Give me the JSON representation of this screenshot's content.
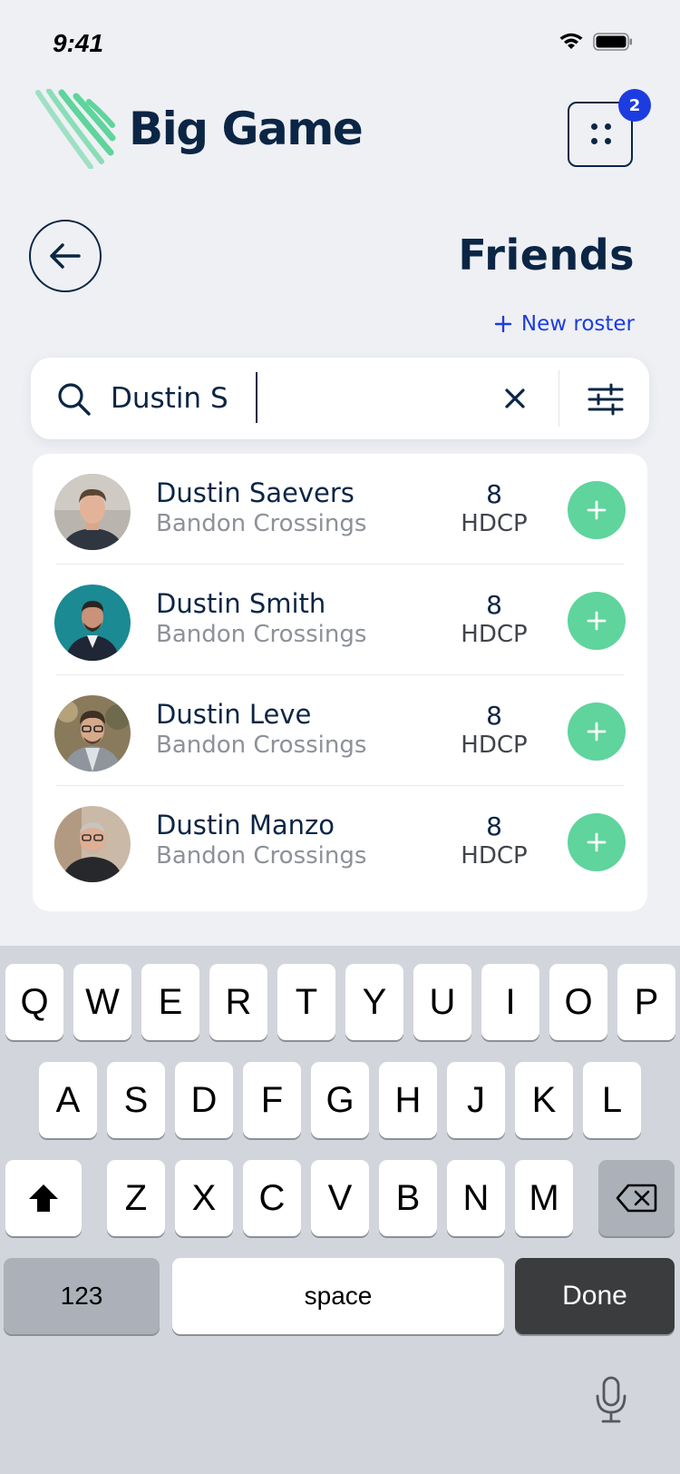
{
  "status_bar": {
    "time": "9:41"
  },
  "header": {
    "app_name": "Big Game",
    "notification_count": "2"
  },
  "page": {
    "title": "Friends",
    "new_roster_label": "New roster"
  },
  "search": {
    "value": "Dustin S"
  },
  "results": [
    {
      "name": "Dustin Saevers",
      "club": "Bandon Crossings",
      "hdcp_value": "8",
      "hdcp_label": "HDCP"
    },
    {
      "name": "Dustin Smith",
      "club": "Bandon Crossings",
      "hdcp_value": "8",
      "hdcp_label": "HDCP"
    },
    {
      "name": "Dustin Leve",
      "club": "Bandon Crossings",
      "hdcp_value": "8",
      "hdcp_label": "HDCP"
    },
    {
      "name": "Dustin Manzo",
      "club": "Bandon Crossings",
      "hdcp_value": "8",
      "hdcp_label": "HDCP"
    }
  ],
  "keyboard": {
    "row1": [
      "Q",
      "W",
      "E",
      "R",
      "T",
      "Y",
      "U",
      "I",
      "O",
      "P"
    ],
    "row2": [
      "A",
      "S",
      "D",
      "F",
      "G",
      "H",
      "J",
      "K",
      "L"
    ],
    "row3": [
      "Z",
      "X",
      "C",
      "V",
      "B",
      "N",
      "M"
    ],
    "numbers_label": "123",
    "space_label": "space",
    "done_label": "Done"
  },
  "colors": {
    "brand_navy": "#0b2545",
    "accent_blue": "#1d3ce0",
    "add_green": "#5fd49c",
    "logo_green": "#5fd49c"
  },
  "icons": [
    "wifi-icon",
    "battery-icon",
    "grid-dots-icon",
    "arrow-left-icon",
    "plus-icon",
    "search-icon",
    "close-icon",
    "sliders-icon",
    "add-icon",
    "shift-icon",
    "backspace-icon",
    "microphone-icon"
  ]
}
